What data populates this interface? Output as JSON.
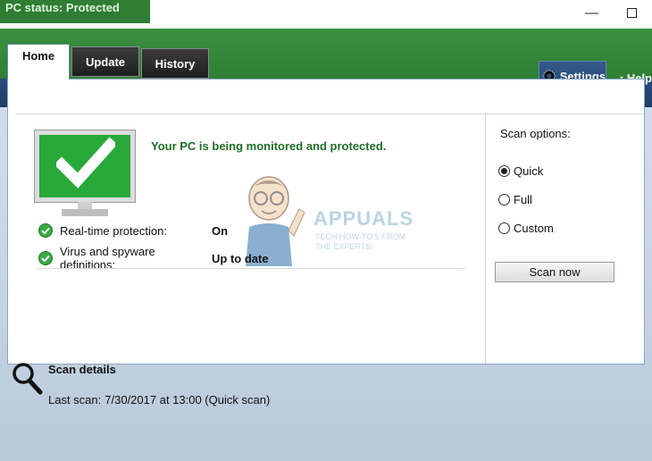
{
  "title_bar": {
    "status_text": "PC status: Protected",
    "minimize_glyph": "—",
    "maximize_icon": "maximize-icon"
  },
  "tabs": [
    {
      "label": "Home",
      "active": true
    },
    {
      "label": "Update",
      "active": false
    },
    {
      "label": "History",
      "active": false
    }
  ],
  "toolbar": {
    "settings_label": "Settings",
    "settings_icon": "gear-icon",
    "help_label": "Help",
    "help_icon": "chevron-down-icon"
  },
  "status": {
    "message": "Your PC is being monitored and protected.",
    "monitor_icon": "monitor-check-icon",
    "details": [
      {
        "label": "Real-time protection:",
        "value": "On",
        "icon": "check-circle-icon"
      },
      {
        "label": "Virus and spyware definitions:",
        "value": "Up to date",
        "icon": "check-circle-icon"
      }
    ]
  },
  "watermark": {
    "brand": "APPUALS",
    "tagline": "TECH HOW-TO'S FROM THE EXPERTS!"
  },
  "scan_options": {
    "title": "Scan options:",
    "options": [
      {
        "label": "Quick",
        "selected": true
      },
      {
        "label": "Full",
        "selected": false
      },
      {
        "label": "Custom",
        "selected": false
      }
    ],
    "scan_now_label": "Scan now"
  },
  "scan_details": {
    "title": "Scan details",
    "icon": "magnifier-icon",
    "last_scan_label": "Last scan:",
    "last_scan_value": "7/30/2017 at 13:00 (Quick scan)"
  },
  "colors": {
    "protected_green": "#29a83a",
    "header_green": "#2f7f34",
    "header_blue": "#1f3d66",
    "status_text_green": "#1f6e24"
  }
}
